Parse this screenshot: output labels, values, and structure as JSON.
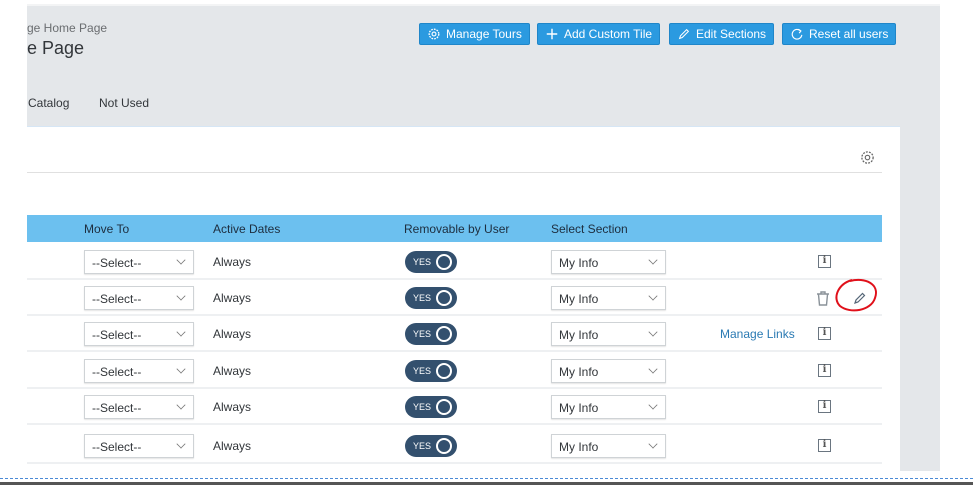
{
  "header": {
    "breadcrumb": "ge Home Page",
    "title": "e Page"
  },
  "tabs": [
    {
      "label": "Catalog"
    },
    {
      "label": "Not Used"
    }
  ],
  "toolbar": {
    "manage_tours": "Manage Tours",
    "add_custom_tile": "Add Custom Tile",
    "edit_sections": "Edit Sections",
    "reset_all_users": "Reset all users"
  },
  "table": {
    "columns": [
      "Move To",
      "Active Dates",
      "Removable by User",
      "Select Section"
    ],
    "rows": [
      {
        "move_to": "--Select--",
        "active": "Always",
        "removable": "YES",
        "section": "My Info",
        "link": "",
        "icons": [
          "info-icon"
        ]
      },
      {
        "move_to": "--Select--",
        "active": "Always",
        "removable": "YES",
        "section": "My Info",
        "link": "",
        "icons": [
          "trash-icon",
          "pencil-icon"
        ]
      },
      {
        "move_to": "--Select--",
        "active": "Always",
        "removable": "YES",
        "section": "My Info",
        "link": "Manage Links",
        "icons": [
          "info-icon"
        ]
      },
      {
        "move_to": "--Select--",
        "active": "Always",
        "removable": "YES",
        "section": "My Info",
        "link": "",
        "icons": [
          "info-icon"
        ]
      },
      {
        "move_to": "--Select--",
        "active": "Always",
        "removable": "YES",
        "section": "My Info",
        "link": "",
        "icons": [
          "info-icon"
        ]
      },
      {
        "move_to": "--Select--",
        "active": "Always",
        "removable": "YES",
        "section": "My Info",
        "link": "",
        "icons": [
          "info-icon"
        ]
      }
    ]
  },
  "colors": {
    "accent": "#2b9ae0",
    "table_header": "#6cc0ef",
    "toggle": "#33506e",
    "annotation": "#e0101a"
  }
}
